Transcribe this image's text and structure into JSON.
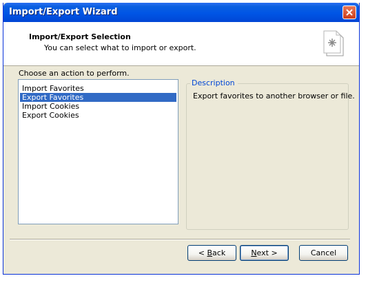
{
  "window": {
    "title": "Import/Export Wizard"
  },
  "header": {
    "title": "Import/Export Selection",
    "subtitle": "You can select what to import or export."
  },
  "main": {
    "choose_label": "Choose an action to perform.",
    "actions": [
      {
        "label": "Import Favorites",
        "selected": false
      },
      {
        "label": "Export Favorites",
        "selected": true
      },
      {
        "label": "Import Cookies",
        "selected": false
      },
      {
        "label": "Export Cookies",
        "selected": false
      }
    ],
    "description_heading": "Description",
    "description_text": "Export favorites to another browser or file."
  },
  "buttons": {
    "back_mnemonic": "B",
    "back_rest": "ack",
    "back_prefix": "< ",
    "next_mnemonic": "N",
    "next_rest": "ext >",
    "cancel": "Cancel"
  },
  "colors": {
    "titlebar": "#0055E5",
    "selection": "#316AC5",
    "dialog_bg": "#ECE9D8",
    "legend_text": "#0046D5"
  },
  "icons": {
    "close": "close-icon",
    "wizard": "wizard-page-icon"
  }
}
